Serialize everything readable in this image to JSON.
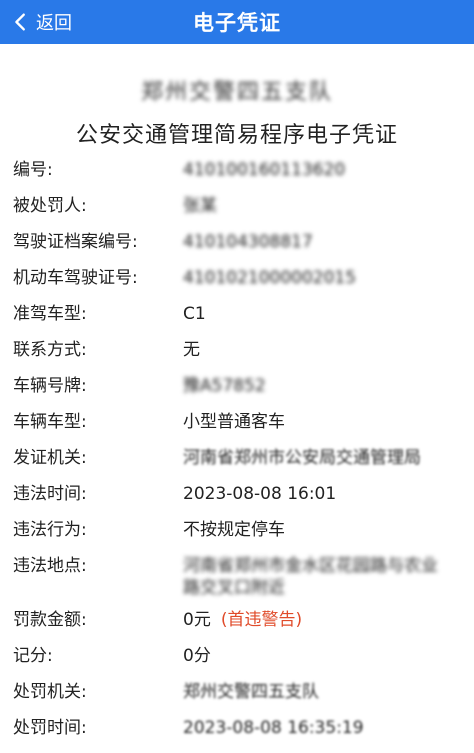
{
  "nav": {
    "back_label": "返回",
    "title": "电子凭证"
  },
  "header": {
    "agency": "郑州交警四五支队",
    "doc_title": "公安交通管理简易程序电子凭证"
  },
  "fields": {
    "number": {
      "label": "编号:",
      "value": "410100160113620"
    },
    "offender": {
      "label": "被处罚人:",
      "value": "张某"
    },
    "license_file_no": {
      "label": "驾驶证档案编号:",
      "value": "410104308817"
    },
    "vehicle_license_no": {
      "label": "机动车驾驶证号:",
      "value": "4101021000002015"
    },
    "license_class": {
      "label": "准驾车型:",
      "value": "C1"
    },
    "contact": {
      "label": "联系方式:",
      "value": "无"
    },
    "plate": {
      "label": "车辆号牌:",
      "value": "豫A57852"
    },
    "vehicle_type": {
      "label": "车辆车型:",
      "value": "小型普通客车"
    },
    "issuing_office": {
      "label": "发证机关:",
      "value": "河南省郑州市公安局交通管理局"
    },
    "violation_time": {
      "label": "违法时间:",
      "value": "2023-08-08 16:01"
    },
    "violation_act": {
      "label": "违法行为:",
      "value": "不按规定停车"
    },
    "violation_place": {
      "label": "违法地点:",
      "value": "河南省郑州市金水区花园路与农业路交叉口附近"
    },
    "fine": {
      "label": "罚款金额:",
      "value": "0元",
      "note": "(首违警告)"
    },
    "points": {
      "label": "记分:",
      "value": "0分"
    },
    "penalty_office": {
      "label": "处罚机关:",
      "value": "郑州交警四五支队"
    },
    "penalty_time": {
      "label": "处罚时间:",
      "value": "2023-08-08 16:35:19"
    }
  },
  "colors": {
    "nav_bg": "#2979e8",
    "warning": "#e04b2a"
  }
}
